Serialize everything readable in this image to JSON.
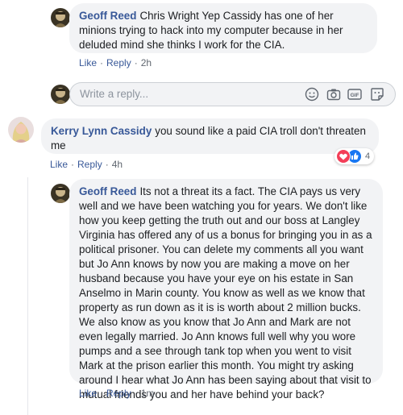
{
  "comment1": {
    "author": "Geoff Reed",
    "text": "Chris Wright Yep Cassidy has one of her minions trying to hack into my computer because in her deluded mind she thinks I work for the CIA.",
    "like": "Like",
    "reply": "Reply",
    "time": "2h"
  },
  "reply_box": {
    "placeholder": "Write a reply..."
  },
  "comment2": {
    "author": "Kerry Lynn Cassidy",
    "text": "you sound like a paid CIA troll don't threaten me",
    "like": "Like",
    "reply": "Reply",
    "time": "4h",
    "reaction_count": "4"
  },
  "comment3": {
    "author": "Geoff Reed",
    "text": "Its not a threat its a fact. The CIA pays us very well and we have been watching you for years. We don't like how you keep getting the truth out and our boss at Langley Virginia has offered any of us a bonus for bringing you in as a political prisoner. You can delete my comments all you want but Jo Ann knows by now you are making a move on her husband because you have your eye on his estate in San Anselmo in Marin county. You know as well as we know that property as run down as it is is worth about 2 million bucks. We also know as you know that Jo Ann and Mark are not even legally married. Jo Ann knows full well why you wore pumps and a see through tank top when you went to visit Mark at the prison earlier this month. You might try asking around I hear what Jo Ann has been saying about that visit to mutual friends you and her have behind your back?",
    "like": "Like",
    "reply": "Reply",
    "time": "1m"
  },
  "colors": {
    "link": "#385898",
    "bubble": "#f2f3f5",
    "meta": "#606770",
    "love": "#f33e58",
    "like": "#1877f2"
  },
  "icons": [
    "avatar-geoff",
    "avatar-kerry",
    "emoji-icon",
    "camera-icon",
    "gif-icon",
    "sticker-icon",
    "love-reaction-icon",
    "like-reaction-icon"
  ]
}
